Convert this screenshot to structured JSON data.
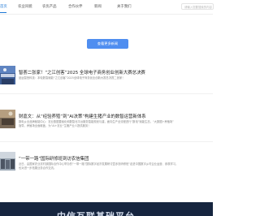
{
  "nav": {
    "active_label": "首页",
    "items": [
      "农业风貌",
      "农优产品",
      "合作伙伴",
      "新闻",
      "关于我们"
    ],
    "search_placeholder": "请输入您要搜索的内容"
  },
  "more_button": "查看更多新闻",
  "news": [
    {
      "title": "智荟二张家！“之江创客”2025 全球电子商务创业创新大赛总决赛",
      "desc": [
        "品运智慧科技：本轮数智赋能“之江创客”2025全球电子商务创业创新大赛总决赛二张家！"
      ]
    },
    {
      "title": "财嘉文：从“经验养殖”到“AI决策”构建生猪产业的数智运营新体系",
      "desc": [
        "数电乡业品牌赋能中心：农业数据要素化和数智化平台服务智能规划与建，面向生产全流程进行“数电”赋能生态，“大数据+养殖场”",
        "指导，养殖场全面覆盖，为“AI+农业”生猪产业人提供服务！"
      ]
    },
    {
      "title": "“一带一路”国际研修班到访农信集团",
      "desc": [
        "近日，由国家农业农村部国际合作中心举办的“一带一路”国际数字经济发展研讨暨涉农研修班“走进中国数字乡村企业运营、参观学习，",
        "也对进一步拓展业务合作交流。"
      ]
    }
  ],
  "banner": {
    "title": "中信互联基础平台"
  },
  "colors": {
    "accent": "#1e78d6",
    "button": "#4f8ef0",
    "banner_bg": "#16253f"
  }
}
